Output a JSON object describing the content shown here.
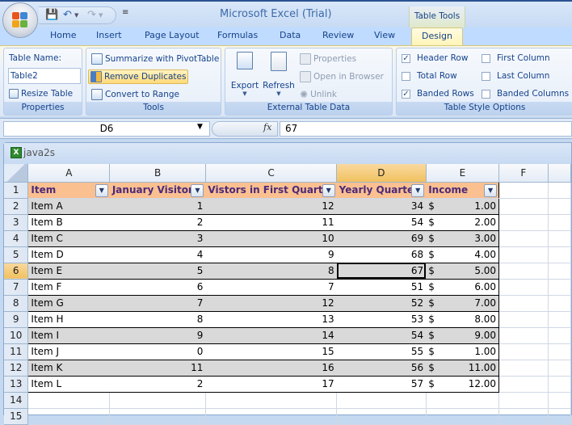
{
  "app": {
    "title": "Microsoft Excel (Trial)",
    "context_header": "Table Tools"
  },
  "qat": {
    "save": "save-icon",
    "undo": "undo-icon",
    "redo": "redo-icon",
    "customize": "customize-icon"
  },
  "tabs": [
    {
      "label": "Home"
    },
    {
      "label": "Insert"
    },
    {
      "label": "Page Layout"
    },
    {
      "label": "Formulas"
    },
    {
      "label": "Data"
    },
    {
      "label": "Review"
    },
    {
      "label": "View"
    },
    {
      "label": "Design",
      "active": true
    }
  ],
  "ribbon": {
    "properties": {
      "label": "Properties",
      "table_name_label": "Table Name:",
      "table_name_value": "Table2",
      "resize": "Resize Table"
    },
    "tools": {
      "label": "Tools",
      "summarize": "Summarize with PivotTable",
      "remove_duplicates": "Remove Duplicates",
      "convert": "Convert to Range"
    },
    "external": {
      "label": "External Table Data",
      "export": "Export",
      "refresh": "Refresh",
      "properties": "Properties",
      "open_browser": "Open in Browser",
      "unlink": "Unlink"
    },
    "style_options": {
      "label": "Table Style Options",
      "header_row": {
        "label": "Header Row",
        "checked": true
      },
      "total_row": {
        "label": "Total Row",
        "checked": false
      },
      "banded_rows": {
        "label": "Banded Rows",
        "checked": true
      },
      "first_column": {
        "label": "First Column",
        "checked": false
      },
      "last_column": {
        "label": "Last Column",
        "checked": false
      },
      "banded_columns": {
        "label": "Banded Columns",
        "checked": false
      }
    }
  },
  "formula_bar": {
    "name_box": "D6",
    "fx": "fx",
    "value": "67"
  },
  "workbook": {
    "title": "java2s"
  },
  "sheet": {
    "columns": [
      "A",
      "B",
      "C",
      "D",
      "E",
      "F"
    ],
    "selected_column": "D",
    "selected_row": 6,
    "headers": [
      "Item",
      "January Visitors",
      "Vistors in First Quarter",
      "Yearly Quarter",
      "Income"
    ],
    "currency_symbol": "$",
    "rows": [
      {
        "n": "2",
        "item": "Item A",
        "jan": "1",
        "q1": "12",
        "yearly": "34",
        "income": "1.00"
      },
      {
        "n": "3",
        "item": "Item B",
        "jan": "2",
        "q1": "11",
        "yearly": "54",
        "income": "2.00"
      },
      {
        "n": "4",
        "item": "Item C",
        "jan": "3",
        "q1": "10",
        "yearly": "69",
        "income": "3.00"
      },
      {
        "n": "5",
        "item": "Item D",
        "jan": "4",
        "q1": "9",
        "yearly": "68",
        "income": "4.00"
      },
      {
        "n": "6",
        "item": "Item E",
        "jan": "5",
        "q1": "8",
        "yearly": "67",
        "income": "5.00"
      },
      {
        "n": "7",
        "item": "Item F",
        "jan": "6",
        "q1": "7",
        "yearly": "51",
        "income": "6.00"
      },
      {
        "n": "8",
        "item": "Item G",
        "jan": "7",
        "q1": "12",
        "yearly": "52",
        "income": "7.00"
      },
      {
        "n": "9",
        "item": "Item H",
        "jan": "8",
        "q1": "13",
        "yearly": "53",
        "income": "8.00"
      },
      {
        "n": "10",
        "item": "Item I",
        "jan": "9",
        "q1": "14",
        "yearly": "54",
        "income": "9.00"
      },
      {
        "n": "11",
        "item": "Item J",
        "jan": "0",
        "q1": "15",
        "yearly": "55",
        "income": "1.00"
      },
      {
        "n": "12",
        "item": "Item K",
        "jan": "11",
        "q1": "16",
        "yearly": "56",
        "income": "11.00"
      },
      {
        "n": "13",
        "item": "Item L",
        "jan": "2",
        "q1": "17",
        "yearly": "57",
        "income": "12.00"
      }
    ],
    "empty_rows": [
      "14",
      "15"
    ]
  },
  "colors": {
    "header_fill": "#fac090",
    "band_fill": "#d9d9d9",
    "header_text": "#4b2a7a",
    "selection": "#f1c15f"
  }
}
